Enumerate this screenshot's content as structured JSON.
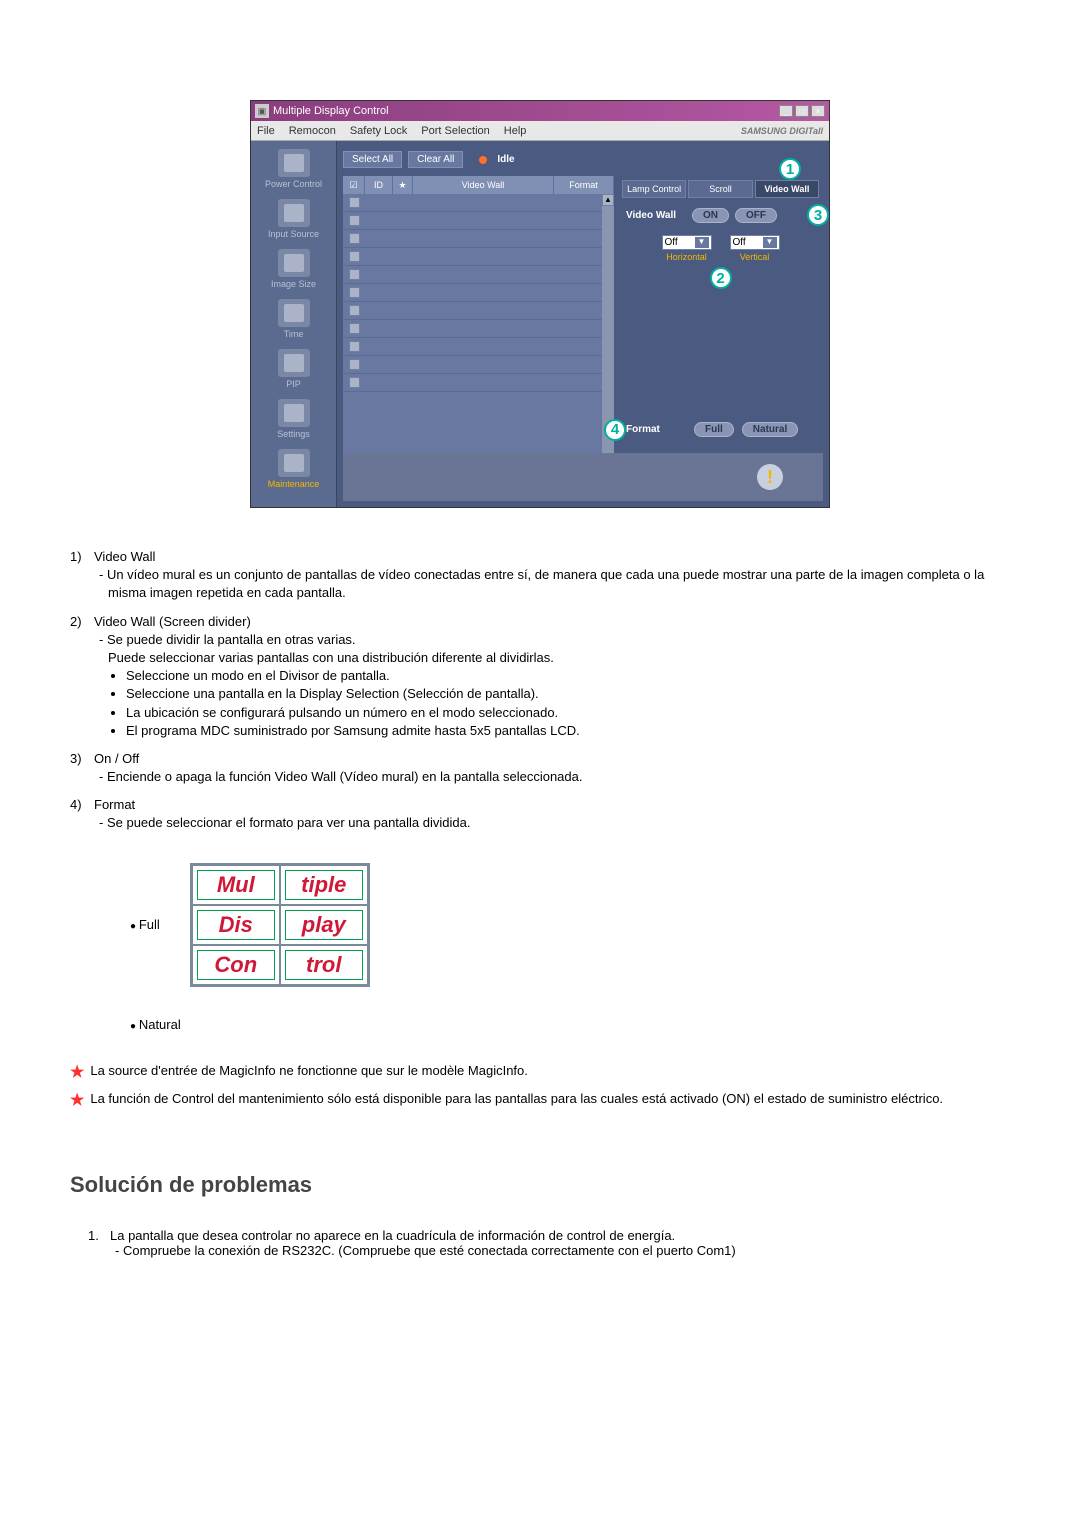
{
  "app": {
    "title": "Multiple Display Control",
    "logo": "SAMSUNG DIGITall",
    "menu": [
      "File",
      "Remocon",
      "Safety Lock",
      "Port Selection",
      "Help"
    ]
  },
  "sidebar": {
    "items": [
      {
        "label": "Power Control"
      },
      {
        "label": "Input Source"
      },
      {
        "label": "Image Size"
      },
      {
        "label": "Time"
      },
      {
        "label": "PIP"
      },
      {
        "label": "Settings"
      },
      {
        "label": "Maintenance"
      }
    ]
  },
  "toolbar": {
    "select_all": "Select All",
    "clear_all": "Clear All",
    "idle": "Idle"
  },
  "table": {
    "th_check": "☑",
    "th_id": "ID",
    "th_star": "★",
    "th_vw": "Video Wall",
    "th_format": "Format"
  },
  "rpanel": {
    "tabs": [
      "Lamp Control",
      "Scroll",
      "Video Wall"
    ],
    "vw_label": "Video Wall",
    "on": "ON",
    "off": "OFF",
    "sel_h_val": "Off",
    "sel_h_lbl": "Horizontal",
    "sel_v_val": "Off",
    "sel_v_lbl": "Vertical",
    "format_label": "Format",
    "full": "Full",
    "natural": "Natural"
  },
  "callouts": {
    "1": "1",
    "2": "2",
    "3": "3",
    "4": "4"
  },
  "desc": {
    "1": {
      "num": "1)",
      "title": "Video Wall",
      "line": "Un vídeo mural es un conjunto de pantallas de vídeo conectadas entre sí, de manera que cada una puede mostrar una parte de la imagen completa o la misma imagen repetida en cada pantalla."
    },
    "2": {
      "num": "2)",
      "title": "Video Wall (Screen divider)",
      "line": "Se puede dividir la pantalla en otras varias.",
      "line2": "Puede seleccionar varias pantallas con una distribución diferente al dividirlas.",
      "b1": "Seleccione un modo en el Divisor de pantalla.",
      "b2": "Seleccione una pantalla en la Display Selection (Selección de pantalla).",
      "b3": "La ubicación se configurará pulsando un número en el modo seleccionado.",
      "b4": "El programa MDC suministrado por Samsung admite hasta 5x5 pantallas LCD."
    },
    "3": {
      "num": "3)",
      "title": "On / Off",
      "line": "Enciende o apaga la función Video Wall (Vídeo mural) en la pantalla seleccionada."
    },
    "4": {
      "num": "4)",
      "title": "Format",
      "line": "Se puede seleccionar el formato para ver una pantalla dividida."
    }
  },
  "format_examples": {
    "full": "Full",
    "natural": "Natural",
    "grid_text": [
      "Mul",
      "tiple",
      "Dis",
      "play",
      "Con",
      "trol"
    ]
  },
  "notes": {
    "1": "La source d'entrée de MagicInfo ne fonctionne que sur le modèle MagicInfo.",
    "2": "La función de Control del mantenimiento sólo está disponible para las pantallas para las cuales está activado (ON) el estado de suministro eléctrico."
  },
  "heading": "Solución de problemas",
  "ts": {
    "1n": "1.",
    "1": "La pantalla que desea controlar no aparece en la cuadrícula de información de control de energía.",
    "1sub": "Compruebe la conexión de RS232C. (Compruebe que esté conectada correctamente con el puerto Com1)"
  }
}
